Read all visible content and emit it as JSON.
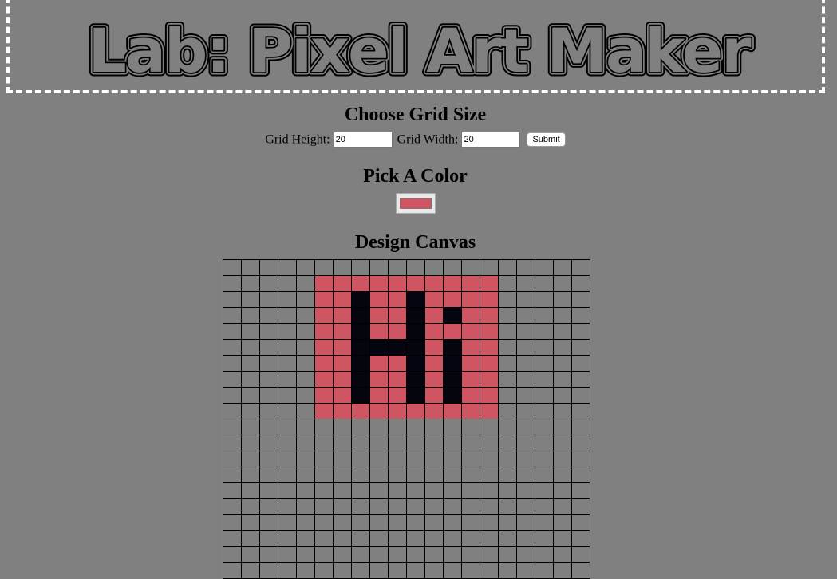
{
  "header": {
    "title": "Lab: Pixel Art Maker"
  },
  "grid_size": {
    "heading": "Choose Grid Size",
    "height_label": "Grid Height:",
    "height_value": "20",
    "width_label": "Grid Width:",
    "width_value": "20",
    "submit_label": "Submit"
  },
  "color_picker": {
    "heading": "Pick A Color",
    "value": "#d05563"
  },
  "design_canvas": {
    "heading": "Design Canvas",
    "rows": 20,
    "cols": 20,
    "background_color": "#808080",
    "pixel_art": [
      "....................",
      ".....DDDDDDDDDD.....",
      ".....DDBDDBDDDD.....",
      ".....DDBDDBDBDD.....",
      ".....DDBDDBDDDD.....",
      ".....DDBBBBDBDD.....",
      ".....DDBDDBDBDD.....",
      ".....DDBDDBDBDD.....",
      ".....DDBDDBDBDD.....",
      ".....DDDDDDDDDD.....",
      "....................",
      "....................",
      "....................",
      "....................",
      "....................",
      "....................",
      "....................",
      "....................",
      "....................",
      "...................."
    ],
    "palette": {
      "D": "#d05563",
      "B": "#05050f"
    }
  }
}
